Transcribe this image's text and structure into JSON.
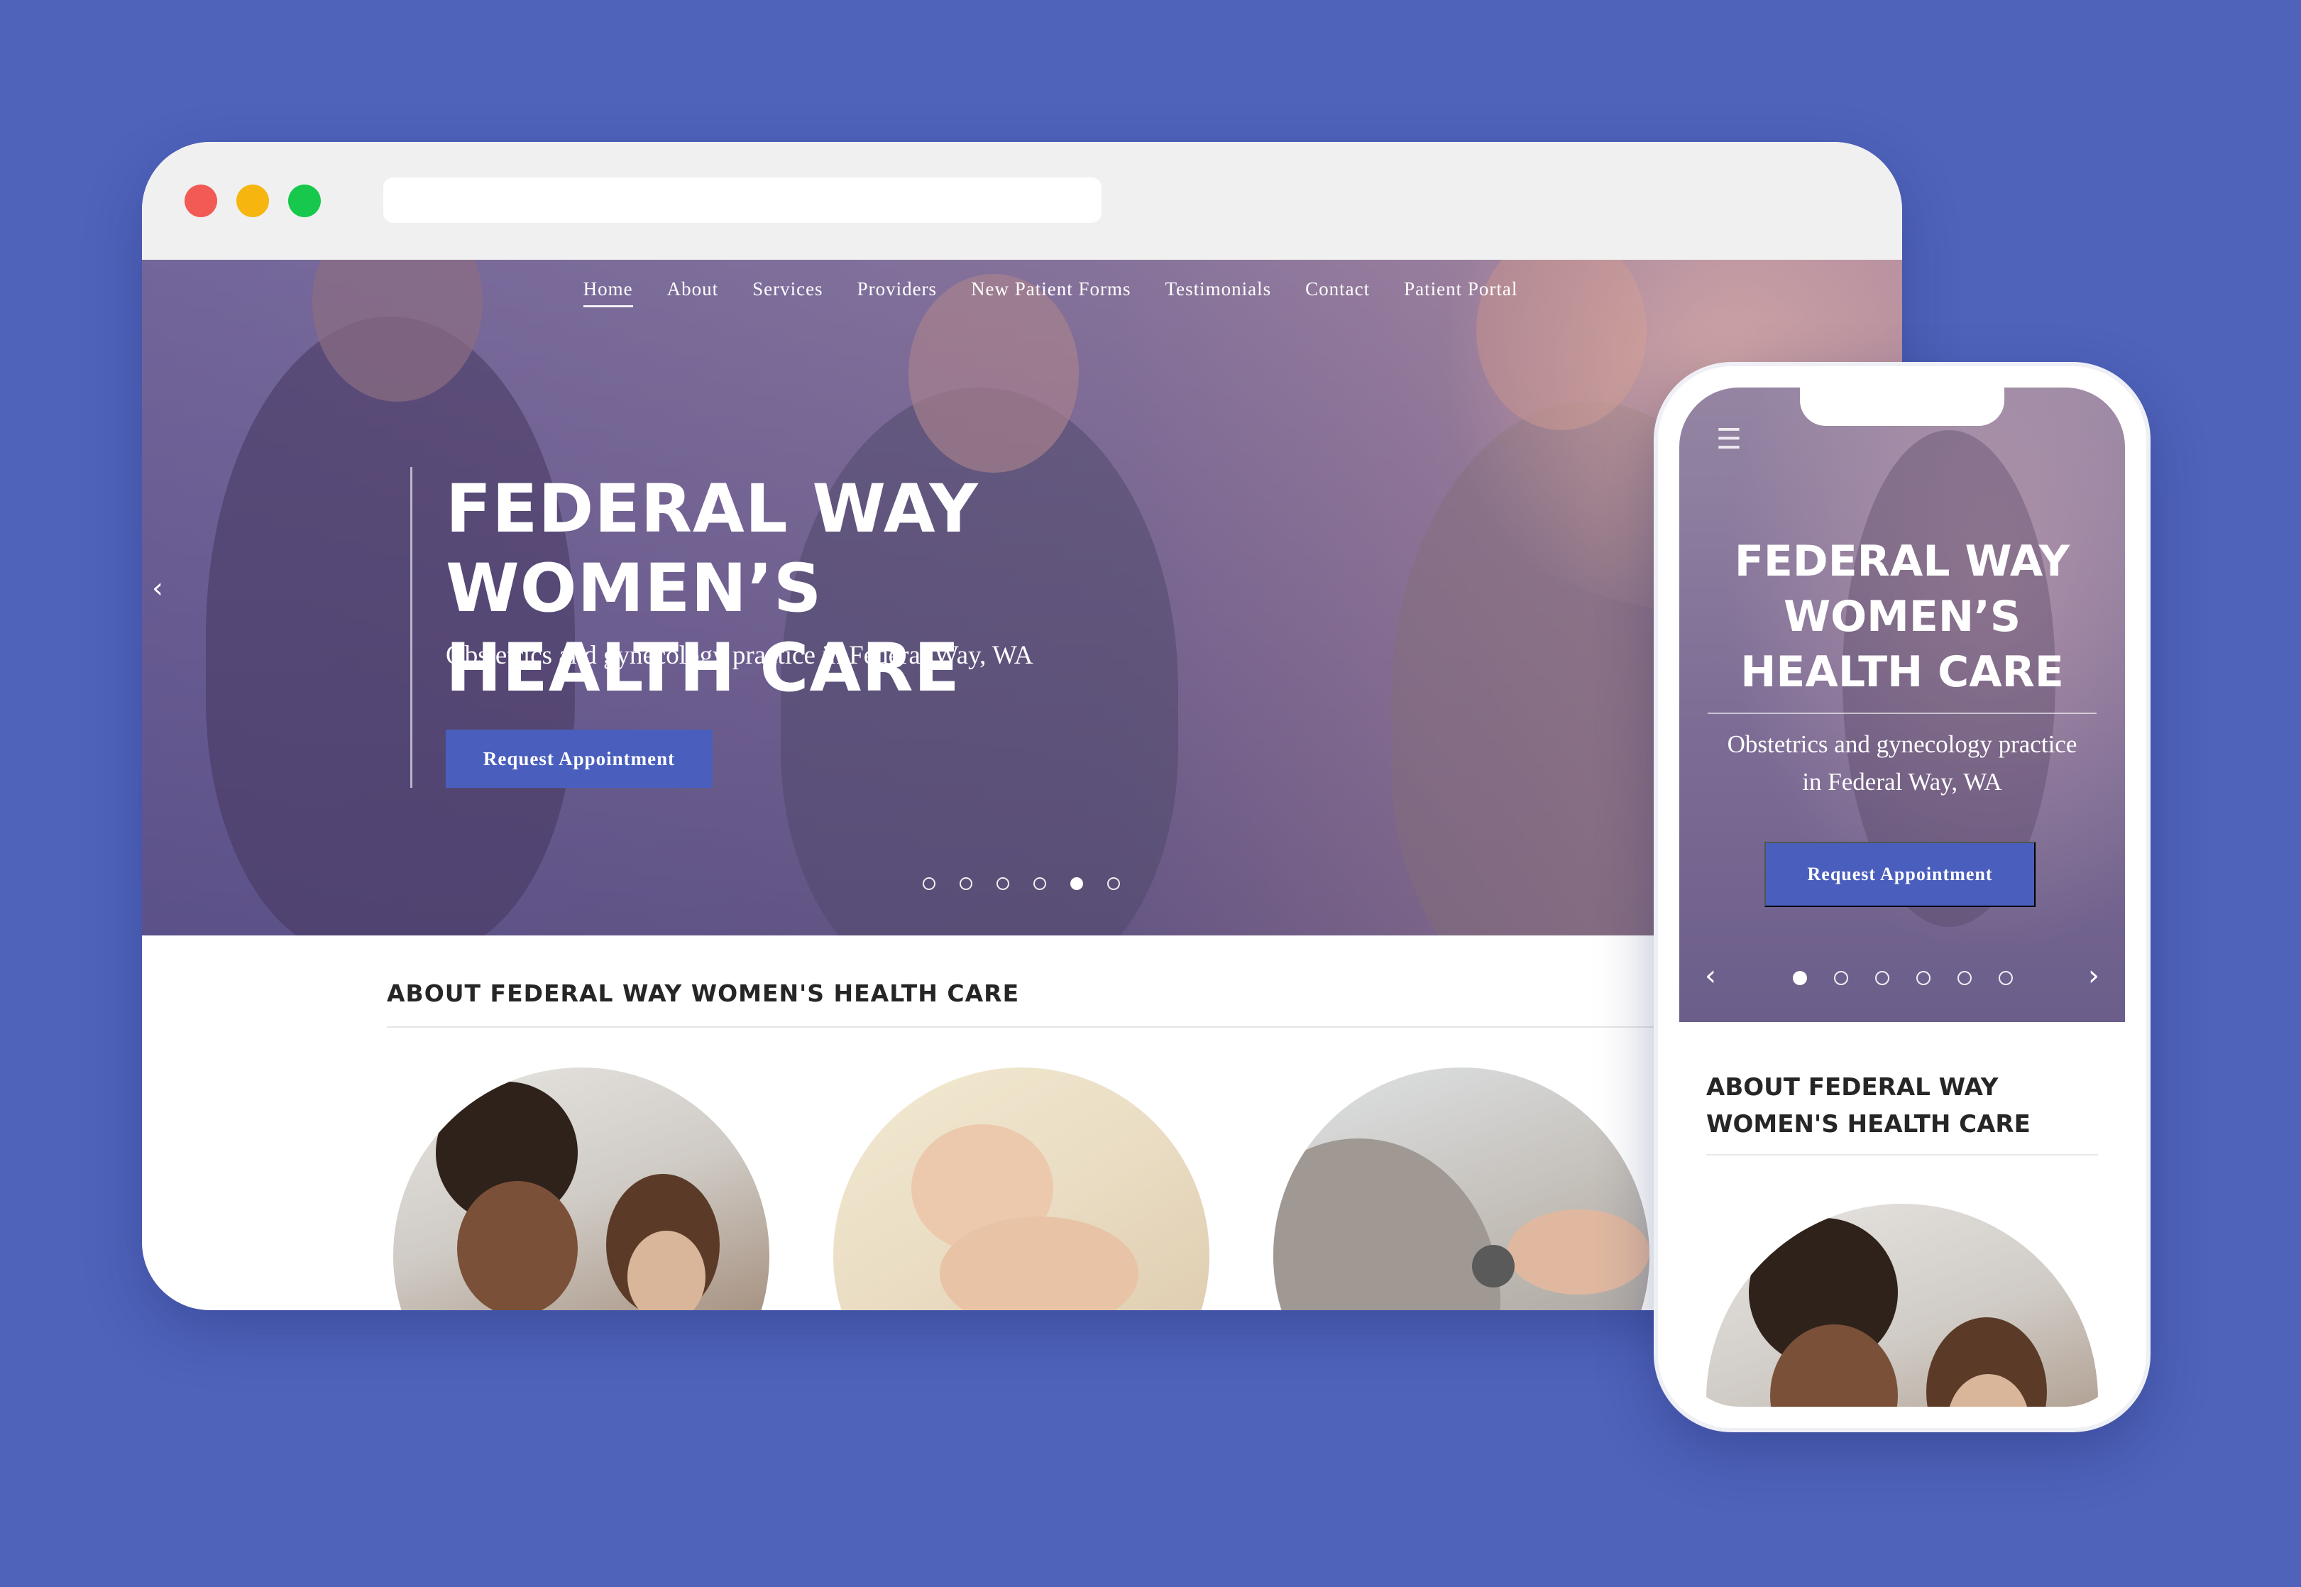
{
  "desktop": {
    "nav": {
      "items": [
        "Home",
        "About",
        "Services",
        "Providers",
        "New Patient Forms",
        "Testimonials",
        "Contact",
        "Patient Portal"
      ],
      "active": "Home"
    },
    "hero": {
      "title_line1": "FEDERAL WAY WOMEN’S",
      "title_line2": "HEALTH CARE",
      "subtitle": "Obstetrics and gynecology practice in Federal Way, WA",
      "button": "Request Appointment",
      "prev_arrow": "‹",
      "carousel_active_index": 4,
      "carousel_count": 6
    },
    "about": {
      "title": "ABOUT FEDERAL WAY WOMEN'S HEALTH CARE"
    }
  },
  "mobile": {
    "menu_icon": "☰",
    "hero": {
      "title_line1": "FEDERAL WAY",
      "title_line2": "WOMEN’S",
      "title_line3": "HEALTH CARE",
      "subtitle_line1": "Obstetrics and gynecology practice",
      "subtitle_line2": "in Federal Way, WA",
      "button": "Request Appointment",
      "prev_arrow": "‹",
      "next_arrow": "›",
      "carousel_active_index": 0,
      "carousel_count": 6
    },
    "about": {
      "title_line1": "ABOUT FEDERAL WAY",
      "title_line2": "WOMEN'S HEALTH CARE"
    }
  },
  "colors": {
    "background": "#4f63bb",
    "button": "#4a5fbd",
    "traffic_red": "#f25a55",
    "traffic_yellow": "#f6b60f",
    "traffic_green": "#17c84c"
  }
}
